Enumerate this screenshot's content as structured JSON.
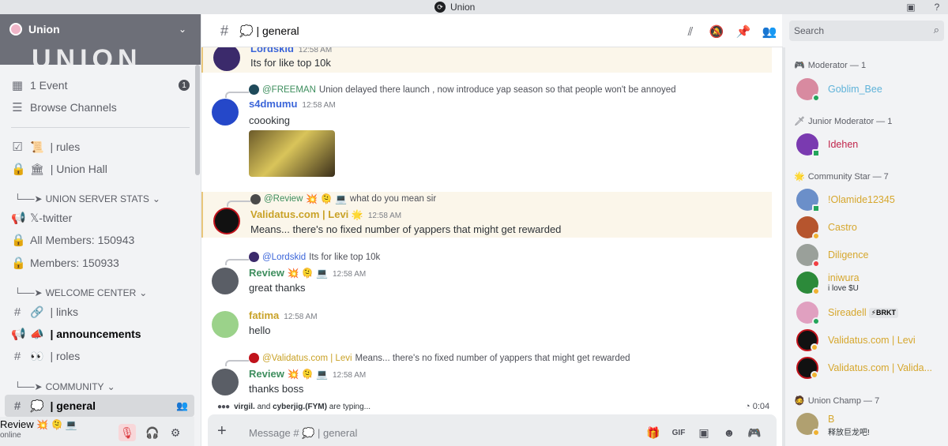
{
  "app": {
    "title": "Union"
  },
  "server": {
    "name": "Union",
    "banner_text": "UNION"
  },
  "sidebar": {
    "events": {
      "label": "1 Event",
      "count": "1"
    },
    "browse": {
      "label": "Browse Channels"
    },
    "channels_top": [
      {
        "icon": "📜",
        "label": "| rules"
      },
      {
        "icon": "🏛",
        "label": "| Union Hall"
      }
    ],
    "categories": [
      {
        "label": "UNION SERVER STATS"
      },
      {
        "label": "WELCOME CENTER"
      },
      {
        "label": "COMMUNITY"
      }
    ],
    "stats_channels": [
      {
        "label": "𝕏-twitter"
      },
      {
        "label": "All Members: 150943"
      },
      {
        "label": "Members: 150933"
      }
    ],
    "welcome_channels": [
      {
        "icon": "🔗",
        "label": "| links"
      },
      {
        "icon": "📣",
        "label": "| announcements"
      },
      {
        "icon": "👀",
        "label": "| roles"
      }
    ],
    "community_channels": [
      {
        "icon": "💭",
        "label": "| general"
      }
    ]
  },
  "user_panel": {
    "name": "Review",
    "name_emojis": "💥 🫠 💻",
    "status": "online"
  },
  "channel_header": {
    "emoji": "💭",
    "name": "| general"
  },
  "search": {
    "placeholder": "Search"
  },
  "messages": [
    {
      "author": "Lordskid",
      "time": "12:58 AM",
      "content": "Its for like top 10k"
    },
    {
      "reply_author": "@FREEMAN",
      "reply_text": "Union delayed there launch , now introduce  yap season so that people won't be annoyed",
      "author": "s4dmumu",
      "time": "12:58 AM",
      "content": "coooking"
    },
    {
      "reply_author": "@Review",
      "reply_emojis": "💥 🫠 💻",
      "reply_text": "what do you mean sir",
      "author": "Validatus.com | Levi",
      "author_emoji": "🌟",
      "time": "12:58 AM",
      "content": "Means... there's no fixed number of yappers that might get rewarded"
    },
    {
      "reply_author": "@Lordskid",
      "reply_text": "Its for like top 10k",
      "author": "Review",
      "author_emojis": "💥 🫠 💻",
      "time": "12:58 AM",
      "content": "great thanks"
    },
    {
      "author": "fatima",
      "time": "12:58 AM",
      "content": "hello"
    },
    {
      "reply_author": "@Validatus.com | Levi",
      "reply_text": "Means... there's no fixed number of yappers that might get rewarded",
      "author": "Review",
      "author_emojis": "💥 🫠 💻",
      "time": "12:58 AM",
      "content": "thanks boss"
    }
  ],
  "typing": {
    "user1": "virgil.",
    "and": "and",
    "user2": "cyberjig.(FYM)",
    "suffix": "are typing..."
  },
  "timer": "0:04",
  "composer": {
    "placeholder": "Message # 💭 | general"
  },
  "member_groups": [
    {
      "label": "Moderator — 1",
      "icon": "🎮"
    },
    {
      "label": "Junior Moderator — 1",
      "icon": "🗡"
    },
    {
      "label": "Community Star — 7",
      "icon": "🌟"
    },
    {
      "label": "Union Champ — 7",
      "icon": "🧔"
    }
  ],
  "members": [
    {
      "name": "Goblim_Bee",
      "color": "#5fb3d9",
      "status": "online"
    },
    {
      "name": "Idehen",
      "color": "#c0254b",
      "status": "mobile"
    },
    {
      "name": "!Olamide12345",
      "color": "#d6a72e",
      "status": "mobile"
    },
    {
      "name": "Castro",
      "color": "#d6a72e",
      "status": "idle"
    },
    {
      "name": "Diligence",
      "color": "#d6a72e",
      "status": "dnd"
    },
    {
      "name": "iniwura",
      "color": "#d6a72e",
      "status": "idle",
      "sub": "i love $U"
    },
    {
      "name": "Sireadell",
      "color": "#d6a72e",
      "status": "online",
      "badge": "⚡BRKT"
    },
    {
      "name": "Validatus.com | Levi",
      "color": "#d6a72e",
      "status": "idle"
    },
    {
      "name": "Validatus.com | Valida...",
      "color": "#d6a72e",
      "status": "idle"
    },
    {
      "name": "B",
      "color": "#d6a72e",
      "status": "idle",
      "sub": "释放巨龙吧!"
    }
  ],
  "colors": {
    "mention_green": "#3e8e5e",
    "review_green": "#3e8e5e",
    "validatus_gold": "#c9a227",
    "fatima_gold": "#c9a227",
    "s4dmumu_blue": "#3b65d9"
  }
}
